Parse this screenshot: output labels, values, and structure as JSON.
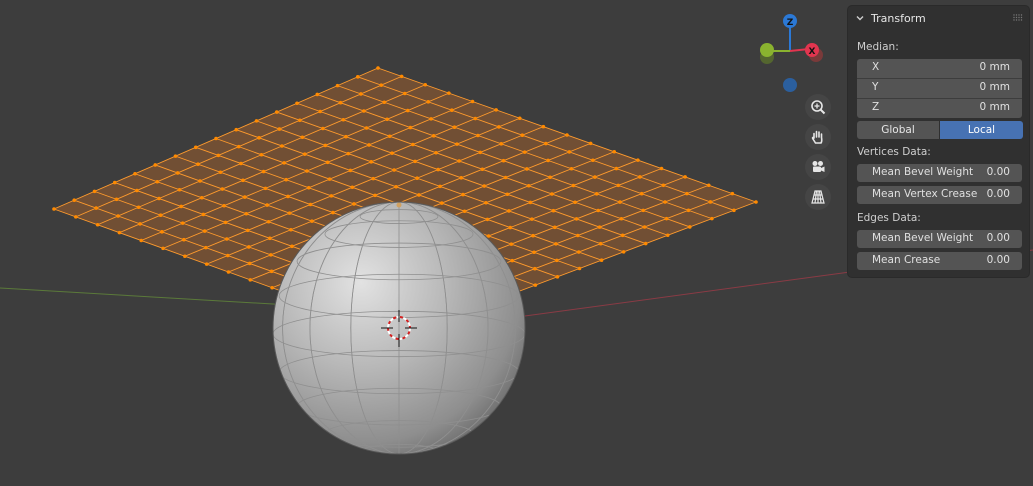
{
  "viewport": {
    "nav_gizmo": {
      "axis_z_label": "Z",
      "axis_x_label": "X",
      "z_color": "#2b79d6",
      "x_color": "#e2354f",
      "y_color": "#8ab32f"
    },
    "tools": {
      "zoom": "zoom-icon",
      "pan": "hand-icon",
      "camera": "camera-icon",
      "perspective": "grid-perspective-icon"
    },
    "mesh_colors": {
      "selected_edge": "#ff9b2d",
      "selected_face": "#7a5233",
      "vertex": "#ff8a00",
      "sphere": "#a9a9a9"
    }
  },
  "panel": {
    "title": "Transform",
    "median_label": "Median:",
    "median": [
      {
        "axis": "X",
        "value": "0 mm"
      },
      {
        "axis": "Y",
        "value": "0 mm"
      },
      {
        "axis": "Z",
        "value": "0 mm"
      }
    ],
    "space_options": [
      "Global",
      "Local"
    ],
    "space_selected": "Local",
    "vertices_label": "Vertices Data:",
    "vertices": [
      {
        "label": "Mean Bevel Weight",
        "value": "0.00"
      },
      {
        "label": "Mean Vertex Crease",
        "value": "0.00"
      }
    ],
    "edges_label": "Edges Data:",
    "edges": [
      {
        "label": "Mean Bevel Weight",
        "value": "0.00"
      },
      {
        "label": "Mean Crease",
        "value": "0.00"
      }
    ]
  }
}
